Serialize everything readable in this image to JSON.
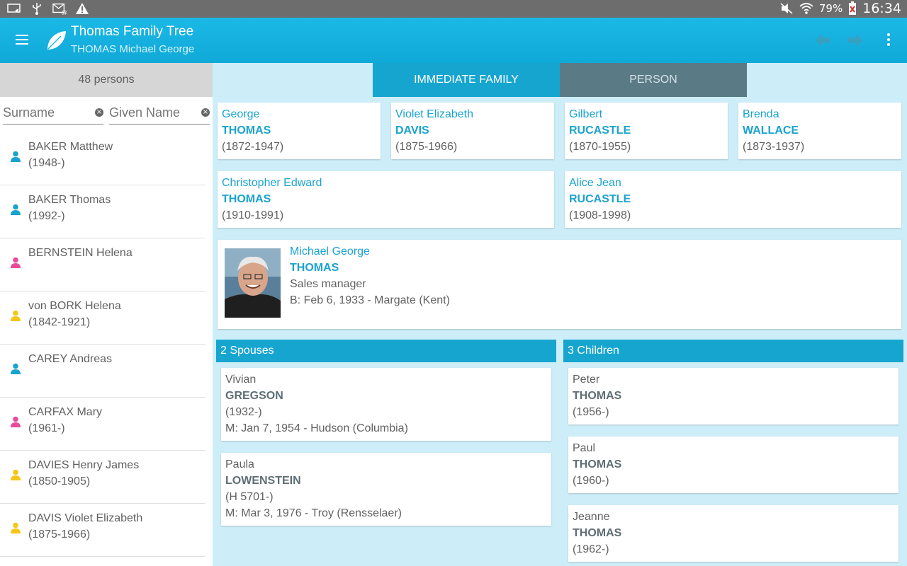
{
  "status_bar": {
    "battery": "79%",
    "time": "16:34"
  },
  "app_bar": {
    "title": "Thomas Family Tree",
    "subtitle": "THOMAS Michael George"
  },
  "sidebar": {
    "count_label": "48 persons",
    "surname_placeholder": "Surname",
    "given_placeholder": "Given Name",
    "persons": [
      {
        "name": "BAKER Matthew",
        "dates": "(1948-)",
        "gender": "male"
      },
      {
        "name": "BAKER Thomas",
        "dates": "(1992-)",
        "gender": "male"
      },
      {
        "name": "BERNSTEIN Helena",
        "dates": "",
        "gender": "female"
      },
      {
        "name": "von BORK Helena",
        "dates": "(1842-1921)",
        "gender": "unknown"
      },
      {
        "name": "CAREY Andreas",
        "dates": "",
        "gender": "male"
      },
      {
        "name": "CARFAX Mary",
        "dates": "(1961-)",
        "gender": "female"
      },
      {
        "name": "DAVIES Henry James",
        "dates": "(1850-1905)",
        "gender": "unknown"
      },
      {
        "name": "DAVIS Violet Elizabeth",
        "dates": "(1875-1966)",
        "gender": "unknown"
      }
    ]
  },
  "tabs": {
    "immediate": "IMMEDIATE FAMILY",
    "person": "PERSON"
  },
  "grandparents": [
    {
      "given": "George",
      "surname": "THOMAS",
      "dates": "(1872-1947)"
    },
    {
      "given": "Violet Elizabeth",
      "surname": "DAVIS",
      "dates": "(1875-1966)"
    },
    {
      "given": "Gilbert",
      "surname": "RUCASTLE",
      "dates": "(1870-1955)"
    },
    {
      "given": "Brenda",
      "surname": "WALLACE",
      "dates": "(1873-1937)"
    }
  ],
  "parents": [
    {
      "given": "Christopher Edward",
      "surname": "THOMAS",
      "dates": "(1910-1991)"
    },
    {
      "given": "Alice Jean",
      "surname": "RUCASTLE",
      "dates": "(1908-1998)"
    }
  ],
  "main_person": {
    "given": "Michael George",
    "surname": "THOMAS",
    "occupation": "Sales manager",
    "birth": "B: Feb 6, 1933 - Margate (Kent)"
  },
  "spouses": {
    "header": "2 Spouses",
    "items": [
      {
        "given": "Vivian",
        "surname": "GREGSON",
        "dates": "(1932-)",
        "marriage": "M: Jan 7, 1954 - Hudson (Columbia)"
      },
      {
        "given": "Paula",
        "surname": "LOWENSTEIN",
        "dates": "(H 5701-)",
        "marriage": "M: Mar 3, 1976 - Troy (Rensselaer)"
      }
    ]
  },
  "children": {
    "header": "3 Children",
    "items": [
      {
        "given": "Peter",
        "surname": "THOMAS",
        "dates": "(1956-)"
      },
      {
        "given": "Paul",
        "surname": "THOMAS",
        "dates": "(1960-)"
      },
      {
        "given": "Jeanne",
        "surname": "THOMAS",
        "dates": "(1962-)"
      }
    ]
  },
  "colors": {
    "accent": "#16a5cf",
    "male": "#1aa3cf",
    "female": "#e94b9b",
    "unknown": "#f5c518"
  }
}
